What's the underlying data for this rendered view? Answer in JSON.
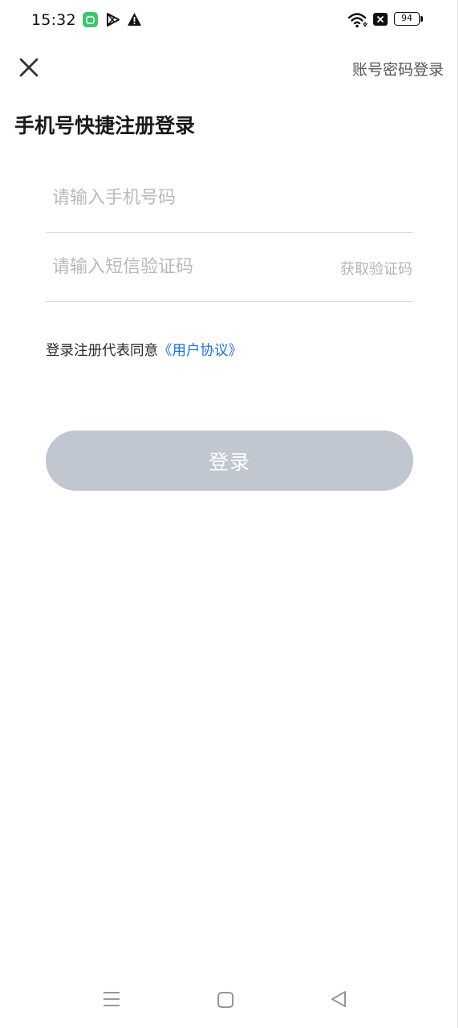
{
  "status_bar": {
    "time": "15:32",
    "battery": "94",
    "icons": [
      "app-notification-icon",
      "play-store-icon",
      "warning-icon",
      "wifi-icon",
      "sim-blocked-icon",
      "battery-icon"
    ]
  },
  "header": {
    "close_icon": "close-icon",
    "password_login": "账号密码登录"
  },
  "title": "手机号快捷注册登录",
  "form": {
    "phone_placeholder": "请输入手机号码",
    "phone_value": "",
    "code_placeholder": "请输入短信验证码",
    "code_value": "",
    "get_code": "获取验证码"
  },
  "agreement": {
    "text": "登录注册代表同意",
    "link": "《用户协议》"
  },
  "login_button": "登录",
  "colors": {
    "link": "#1f6fd6",
    "button_disabled": "#c1c7d0",
    "placeholder": "#b9b9b9"
  },
  "nav_bar": {
    "icons": [
      "menu-icon",
      "home-icon",
      "back-icon"
    ]
  }
}
